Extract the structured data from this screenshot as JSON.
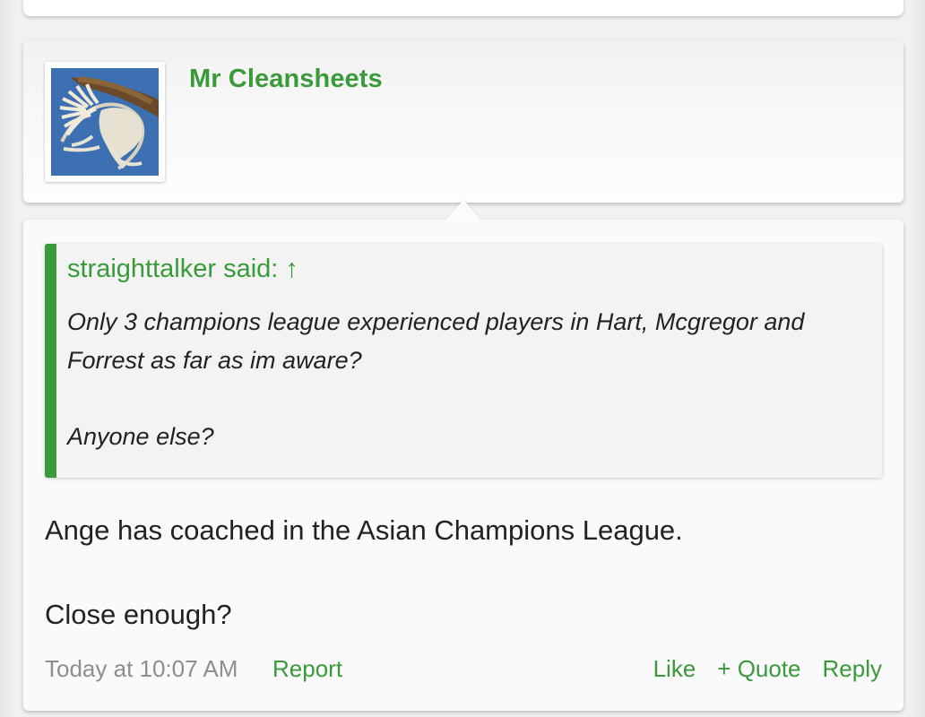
{
  "post": {
    "author": "Mr Cleansheets",
    "avatar": {
      "type": "image",
      "description": "bird-avatar"
    },
    "quote": {
      "author_label": "straighttalker said: ↑",
      "lines": [
        "Only 3 champions league experienced players in Hart, Mcgregor and Forrest as far as im aware?",
        "Anyone else?"
      ]
    },
    "body": [
      "Ange has coached in the Asian Champions League.",
      "Close enough?"
    ],
    "footer": {
      "timestamp": "Today at 10:07 AM",
      "report_label": "Report",
      "like_label": "Like",
      "quote_label": "+ Quote",
      "reply_label": "Reply"
    }
  },
  "colors": {
    "accent": "#3a9a3a",
    "text": "#222222",
    "muted": "#8e8e8e",
    "quote_bg": "#f3f3f3"
  }
}
